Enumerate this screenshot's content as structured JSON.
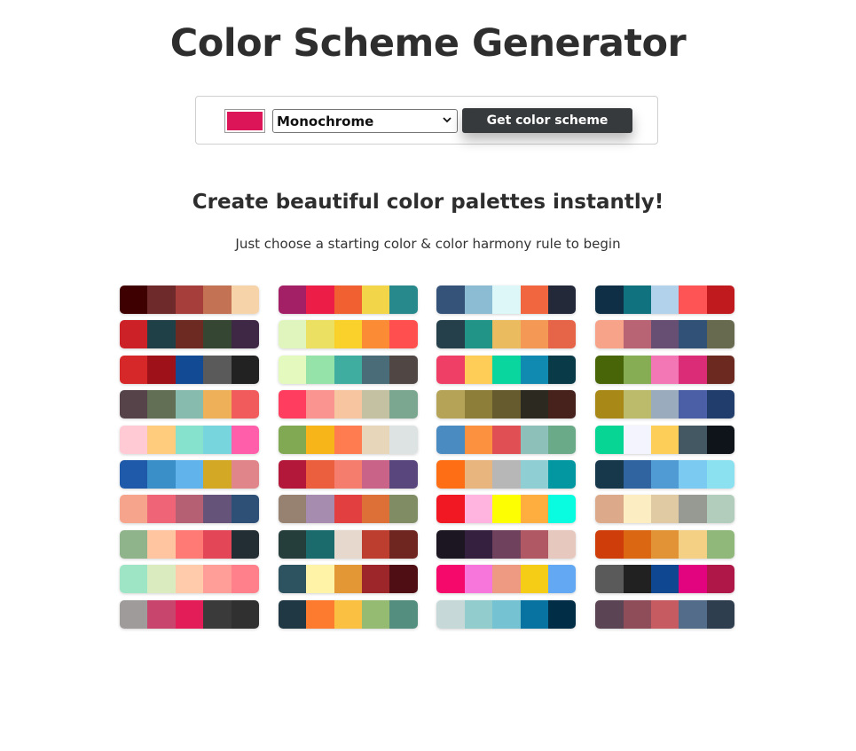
{
  "header": {
    "title": "Color Scheme Generator"
  },
  "controls": {
    "selected_color": "#DC1458",
    "scheme_select": {
      "selected": "Monochrome"
    },
    "button_label": "Get color scheme"
  },
  "intro": {
    "headline": "Create beautiful color palettes instantly!",
    "subline": "Just choose a starting color & color harmony rule to begin"
  },
  "palettes": [
    [
      [
        "#3E0000",
        "#6E2A2A",
        "#A63F3B",
        "#C47254",
        "#F6D3A8"
      ],
      [
        "#CC2126",
        "#1F4046",
        "#6C2A22",
        "#354733",
        "#3F2746"
      ],
      [
        "#D62828",
        "#9E1118",
        "#124B93",
        "#5A5A5A",
        "#222222"
      ],
      [
        "#554349",
        "#636F55",
        "#86BBAD",
        "#EFB05A",
        "#F25B5C"
      ],
      [
        "#FFCAD4",
        "#FFCC7D",
        "#86E2CD",
        "#77D5DD",
        "#FF5FAA"
      ],
      [
        "#1F5AAA",
        "#3B8FC9",
        "#60B4EB",
        "#D3A825",
        "#E0868A"
      ],
      [
        "#F7A48C",
        "#F06478",
        "#B66073",
        "#665379",
        "#2E5077"
      ],
      [
        "#8FB38A",
        "#FFC5A0",
        "#FF7A74",
        "#E34757",
        "#232E34"
      ],
      [
        "#9EE5C6",
        "#DAEBC0",
        "#FFCBAA",
        "#FF9E98",
        "#FF7F8A"
      ],
      [
        "#9F9B9B",
        "#C8466E",
        "#E31D58",
        "#3A3A3A",
        "#303030"
      ]
    ],
    [
      [
        "#A32066",
        "#EC1E47",
        "#F16030",
        "#F2D548",
        "#27898B"
      ],
      [
        "#DFF5BD",
        "#EBE061",
        "#FAD02A",
        "#FC8B36",
        "#FF4F4E"
      ],
      [
        "#E3F9BE",
        "#95E3A8",
        "#3FADA0",
        "#4A6B78",
        "#504644"
      ],
      [
        "#FF3D5E",
        "#FA9491",
        "#F7C59F",
        "#C3C1A1",
        "#7BA68F"
      ],
      [
        "#81A953",
        "#F8B51A",
        "#FF7B50",
        "#E7D6B9",
        "#DDE2E3"
      ],
      [
        "#B3183B",
        "#EB5F3E",
        "#F47D6E",
        "#CA6388",
        "#59467D"
      ],
      [
        "#978271",
        "#A68CAE",
        "#E24040",
        "#DC7036",
        "#7F8C64"
      ],
      [
        "#253D3B",
        "#1C6B6C",
        "#E6D8CC",
        "#BD3D2F",
        "#702620"
      ],
      [
        "#2D5360",
        "#FFF3A8",
        "#E39735",
        "#9D262B",
        "#4F0E14"
      ],
      [
        "#1F3844",
        "#FC7B2E",
        "#FAC042",
        "#95BA72",
        "#538E7E"
      ]
    ],
    [
      [
        "#355279",
        "#8CBCD3",
        "#DDF6F7",
        "#F1653F",
        "#24293A"
      ],
      [
        "#25404A",
        "#229387",
        "#EABC5F",
        "#F49855",
        "#E66549"
      ],
      [
        "#F03F67",
        "#FECD58",
        "#09D59E",
        "#118AB2",
        "#083A47"
      ],
      [
        "#B5A457",
        "#8D7E3A",
        "#665A2F",
        "#2C2A20",
        "#47221D"
      ],
      [
        "#4A8BC1",
        "#FC923F",
        "#DF4F54",
        "#8EC0BA",
        "#6AAA89"
      ],
      [
        "#FD6E15",
        "#E8B57E",
        "#B7B7B7",
        "#8FCFD4",
        "#0397A2"
      ],
      [
        "#F11824",
        "#FFB3DF",
        "#FEFE02",
        "#FDAE3E",
        "#09FCDF"
      ],
      [
        "#1C1622",
        "#35203F",
        "#70415C",
        "#B05863",
        "#E7C8BE"
      ],
      [
        "#F50A6B",
        "#F676DC",
        "#EE9A83",
        "#F5CC16",
        "#62A8F2"
      ],
      [
        "#C6D8D7",
        "#93CCCD",
        "#75C2D2",
        "#0872A1",
        "#022D46"
      ]
    ],
    [
      [
        "#0E2F46",
        "#11727F",
        "#B2D1EA",
        "#FE5456",
        "#C0191E"
      ],
      [
        "#F6A38A",
        "#B96475",
        "#664F73",
        "#325177",
        "#686A50"
      ],
      [
        "#486508",
        "#86AD53",
        "#F277B4",
        "#DB2C78",
        "#6C2920"
      ],
      [
        "#A88917",
        "#BCBB6C",
        "#9AABBE",
        "#4A5FA5",
        "#213D6C"
      ],
      [
        "#06D594",
        "#F3F4FD",
        "#FDCE58",
        "#445863",
        "#0E1419"
      ],
      [
        "#17374B",
        "#2F64A0",
        "#509BD3",
        "#7BCAF1",
        "#8CE1F1"
      ],
      [
        "#DDA98B",
        "#FDEDC3",
        "#DFCAA4",
        "#979A93",
        "#B2CDBB"
      ],
      [
        "#CE3D0A",
        "#DC6712",
        "#E29336",
        "#F3D083",
        "#91B87B"
      ],
      [
        "#5A5A5A",
        "#212121",
        "#0F4890",
        "#E2037E",
        "#AE1747"
      ],
      [
        "#5B4555",
        "#8F4C59",
        "#C65B61",
        "#536C8A",
        "#2E3E4F"
      ]
    ]
  ]
}
